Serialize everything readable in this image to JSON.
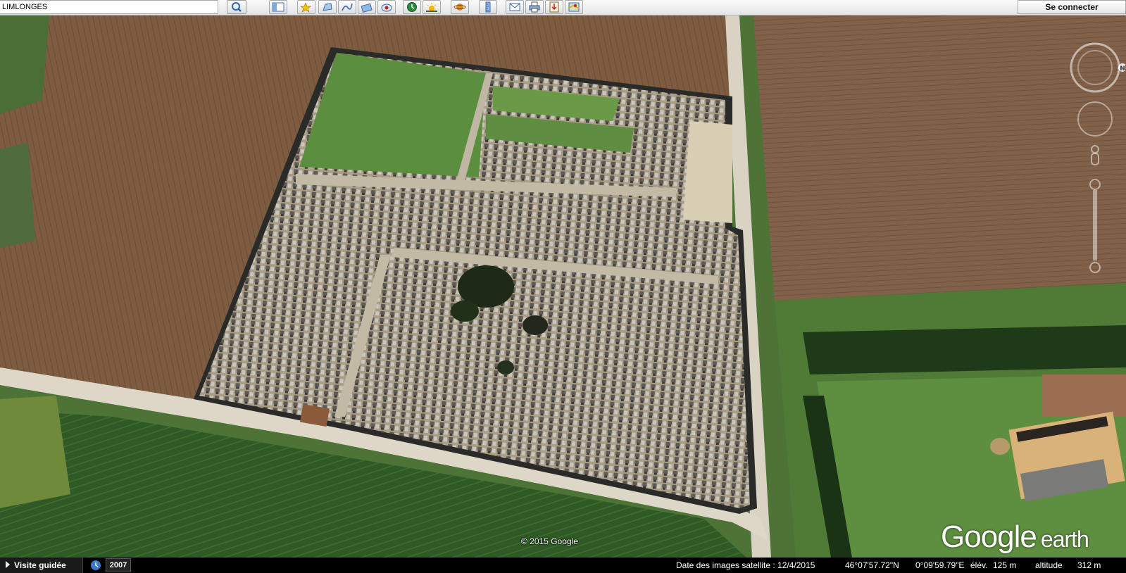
{
  "toolbar": {
    "search_value": "LIMLONGES",
    "buttons": [
      "search-icon",
      "sidebar-toggle-icon",
      "add-placemark-icon",
      "add-polygon-icon",
      "add-path-icon",
      "add-image-overlay-icon",
      "record-tour-icon",
      "historical-imagery-icon",
      "sunlight-icon",
      "planets-icon",
      "ruler-icon",
      "email-icon",
      "print-icon",
      "save-image-icon",
      "view-in-maps-icon"
    ],
    "signin_label": "Se connecter"
  },
  "map": {
    "copyright": "© 2015 Google",
    "logo_main": "Google",
    "logo_sub": "earth"
  },
  "navigation": {
    "north_label": "N"
  },
  "statusbar": {
    "tour_label": "Visite guidée",
    "year": "2007",
    "imagery_date": "Date des images satellite : 12/4/2015",
    "lat": "46°07'57.72\"N",
    "lon": "0°09'59.79\"E",
    "elev_label": "élév.",
    "elev_value": "125 m",
    "alt_label": "altitude",
    "alt_value": "312 m"
  },
  "colors": {
    "field_brown": "#7a5a40",
    "grass_green": "#4f7a34",
    "cemetery_ground": "#a89c84",
    "road": "#d8d2c0"
  }
}
